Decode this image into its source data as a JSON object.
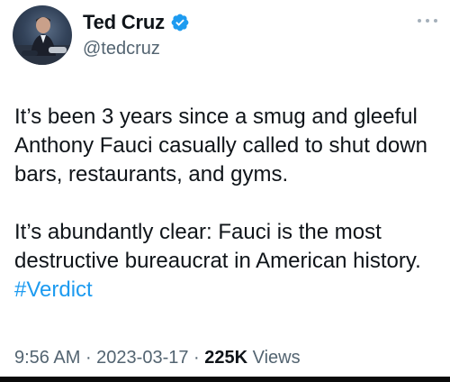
{
  "author": {
    "display_name": "Ted Cruz",
    "handle": "@tedcruz",
    "verified": true,
    "verified_color": "#1d9bf0"
  },
  "tweet": {
    "paragraph1": "It’s been 3 years since a smug and gleeful Anthony Fauci casually called to shut down bars, restaurants, and gyms.",
    "paragraph2_text": "It’s abundantly clear: Fauci is the most destructive bureaucrat in American history. ",
    "hashtag": "#Verdict",
    "hashtag_color": "#1d9bf0"
  },
  "meta": {
    "time": "9:56 AM",
    "separator": " · ",
    "date": "2023-03-17",
    "views_count": "225K",
    "views_label": " Views"
  },
  "icons": {
    "verified": "verified-badge-icon",
    "more": "more-options-icon"
  }
}
